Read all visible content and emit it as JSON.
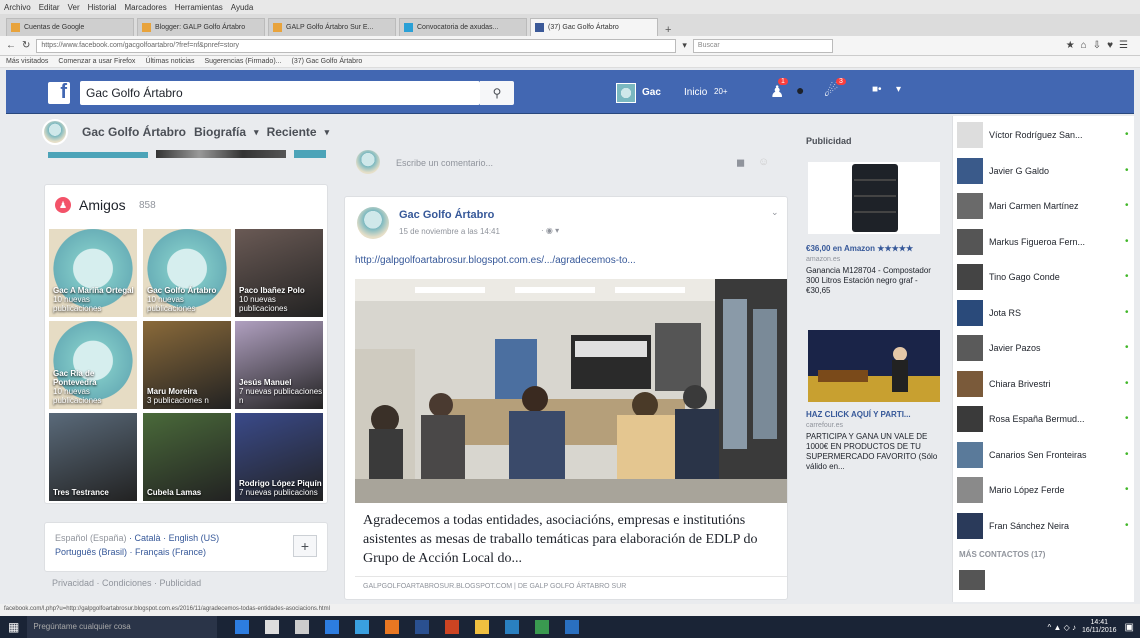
{
  "browser": {
    "menu": [
      "Archivo",
      "Editar",
      "Ver",
      "Historial",
      "Marcadores",
      "Herramientas",
      "Ayuda"
    ],
    "tabs": [
      {
        "label": "Cuentas de Google",
        "active": false
      },
      {
        "label": "Blogger: GALP Golfo Ártabro",
        "active": false
      },
      {
        "label": "GALP Golfo Ártabro Sur E...",
        "active": false
      },
      {
        "label": "Convocatoria de axudas...",
        "active": false
      },
      {
        "label": "(37) Gac Golfo Ártabro",
        "active": true
      }
    ],
    "url": "https://www.facebook.com/gacgolfoartabro/?fref=nf&pnref=story",
    "search_placeholder": "Buscar",
    "bookmarks": [
      "Más visitados",
      "Comenzar a usar Firefox",
      "Últimas noticias",
      "Sugerencias (Firmado)...",
      "(37) Gac Golfo Ártabro"
    ]
  },
  "fb": {
    "search_value": "Gac Golfo Ártabro",
    "nav_name": "Gac",
    "nav_home": "Inicio",
    "nav_home_count": "20+",
    "badges": {
      "friends": "1",
      "notifications": "3"
    }
  },
  "subheader": {
    "page_name": "Gac Golfo Ártabro",
    "biography": "Biografía",
    "recent": "Reciente"
  },
  "friends": {
    "title": "Amigos",
    "count": "858",
    "tiles": [
      {
        "name": "Gac A Mariña Ortegal",
        "sub": "10 nuevas publicaciones",
        "bg": "#7cc4c4"
      },
      {
        "name": "Gac Golfo Ártabro",
        "sub": "10 nuevas publicaciones",
        "bg": "#7cc4c4"
      },
      {
        "name": "Paco Ibañez Polo",
        "sub": "10 nuevas publicaciones",
        "bg": "#6a5a55"
      },
      {
        "name": "Gac Ria de Pontevedra",
        "sub": "10 nuevas publicaciones",
        "bg": "#7cc4c4"
      },
      {
        "name": "Maru Moreira",
        "sub": "3 publicaciones n",
        "bg": "#8a6a3a"
      },
      {
        "name": "Jesús Manuel",
        "sub": "7 nuevas publicaciones n",
        "bg": "#b0a0c0"
      },
      {
        "name": "Tres Testrance",
        "sub": "",
        "bg": "#5a6a7a"
      },
      {
        "name": "Cubela Lamas",
        "sub": "",
        "bg": "#4a6a3a"
      },
      {
        "name": "Rodrigo López Piquín",
        "sub": "7 nuevas publicacions",
        "bg": "#3a4a8a"
      }
    ]
  },
  "languages": {
    "line1": [
      "Español (España)",
      "Català",
      "English (US)"
    ],
    "line2": [
      "Português (Brasil)",
      "Français (France)"
    ],
    "add": "+"
  },
  "footer": "Privacidad · Condiciones · Publicidad",
  "comment": {
    "placeholder": "Escribe un comentario..."
  },
  "post": {
    "author": "Gac Golfo Ártabro",
    "date": "15 de noviembre a las 14:41",
    "link": "http://galpgolfoartabrosur.blogspot.com.es/.../agradecemos-to...",
    "title": "Agradecemos a todas entidades, asociacións, empresas e institutións asistentes as mesas de traballo temáticas para elaboración de EDLP do Grupo de Acción Local do...",
    "source": "GALPGOLFOARTABROSUR.BLOGSPOT.COM | DE GALP GOLFO ÁRTABRO SUR"
  },
  "ads": {
    "heading": "Publicidad",
    "ad1": {
      "title": "€36,00 en Amazon ★★★★★",
      "site": "amazon.es",
      "desc": "Ganancia M128704 - Compostador 300 Litros Estación negro graf - €30,65"
    },
    "ad2": {
      "title": "HAZ CLICK AQUÍ Y PARTI...",
      "site": "carrefour.es",
      "desc": "PARTICIPA Y GANA UN VALE DE 1000€ EN PRODUCTOS DE TU SUPERMERCADO FAVORITO (Sólo válido en..."
    }
  },
  "chat": {
    "contacts": [
      "Víctor Rodríguez San...",
      "Javier G Galdo",
      "Mari Carmen Martínez",
      "Markus Figueroa Fern...",
      "Tino Gago Conde",
      "Jota RS",
      "Javier Pazos",
      "Chiara Brivestri",
      "Rosa España Bermud...",
      "Canarios Sen Fronteiras",
      "Mario López Ferde",
      "Fran Sánchez Neira"
    ],
    "more": "MÁS CONTACTOS (17)"
  },
  "statusbar": "facebook.com/l.php?u=http://galpgolfoartabrosur.blogspot.com.es/2016/11/agradecemos-todas-entidades-asociacions.html",
  "taskbar": {
    "search_placeholder": "Pregúntame cualquier cosa",
    "time": "14:41",
    "date": "16/11/2016"
  }
}
